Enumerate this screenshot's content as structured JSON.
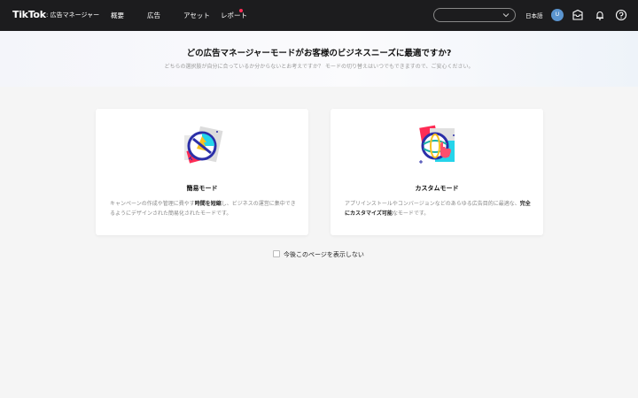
{
  "header": {
    "logo": "TikTok",
    "logo_sub": ": 広告マネージャー",
    "nav": [
      "概要",
      "広告",
      "アセット",
      "レポート"
    ],
    "language": "日本語",
    "avatar_initial": "U",
    "icons": [
      "chevron-down-icon",
      "inbox-icon",
      "bell-icon",
      "help-icon"
    ]
  },
  "banner": {
    "title": "どの広告マネージャーモードがお客様のビジネスニーズに最適ですか?",
    "subtitle": "どちらの選択肢が自分に合っているか分からないとお考えですか？ モードの切り替えはいつでもできますので、ご安心ください。"
  },
  "cards": [
    {
      "title": "簡易モード",
      "desc": [
        {
          "t": "キャンペーンの作成や管理に費やす"
        },
        {
          "t": "時間を短縮",
          "b": true
        },
        {
          "t": "し、ビジネスの運営に集中できるようにデザインされた簡易化されたモードです。"
        }
      ]
    },
    {
      "title": "カスタムモード",
      "desc": [
        {
          "t": "アプリインストールやコンバージョンなどのあらゆる広告目的に最適な、"
        },
        {
          "t": "完全にカスタマイズ可能",
          "b": true
        },
        {
          "t": "なモードです。"
        }
      ]
    }
  ],
  "dont_show_label": "今後このページを表示しない",
  "colors": {
    "accent": "#fe2c55",
    "header_bg": "#1c1c1e",
    "avatar_bg": "#5b95d0"
  }
}
